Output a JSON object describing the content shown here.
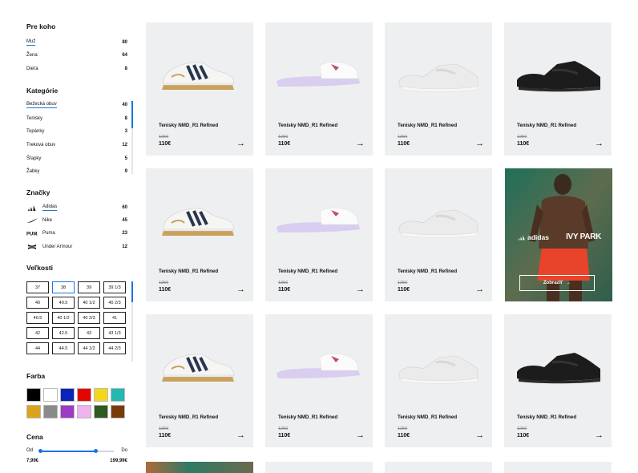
{
  "filters": {
    "audience": {
      "title": "Pre koho",
      "items": [
        {
          "label": "Muž",
          "count": "80"
        },
        {
          "label": "Žena",
          "count": "64"
        },
        {
          "label": "Dieťa",
          "count": "8"
        }
      ]
    },
    "categories": {
      "title": "Kategórie",
      "items": [
        {
          "label": "Bežecká obuv",
          "count": "40"
        },
        {
          "label": "Tenisky",
          "count": "8"
        },
        {
          "label": "Topánky",
          "count": "3"
        },
        {
          "label": "Treková obuv",
          "count": "12"
        },
        {
          "label": "Šľapky",
          "count": "5"
        },
        {
          "label": "Žabky",
          "count": "9"
        }
      ]
    },
    "brands": {
      "title": "Značky",
      "items": [
        {
          "label": "Adidas",
          "count": "60",
          "icon": "adidas-logo-icon"
        },
        {
          "label": "Nike",
          "count": "45",
          "icon": "nike-swoosh-icon"
        },
        {
          "label": "Puma",
          "count": "23",
          "icon": "puma-logo-icon"
        },
        {
          "label": "Under Armour",
          "count": "12",
          "icon": "under-armour-logo-icon"
        }
      ]
    },
    "sizes": {
      "title": "Veľkosti",
      "selected": "38",
      "items": [
        "37",
        "38",
        "39",
        "39 1/3",
        "40",
        "40.5",
        "40 1/2",
        "40 2/3",
        "40.5",
        "40 1/2",
        "40 2/3",
        "41",
        "42",
        "42.5",
        "43",
        "43 1/3",
        "44",
        "44.5",
        "44 1/2",
        "44 2/3"
      ]
    },
    "colors": {
      "title": "Farba",
      "items": [
        "#000000",
        "#ffffff",
        "#0a23b8",
        "#e10600",
        "#f2d81c",
        "#23b8b0",
        "#dba31e",
        "#8a8a8a",
        "#9b3bc6",
        "#f0b3f0",
        "#2f5a1f",
        "#7a3b0a"
      ]
    },
    "price": {
      "title": "Cena",
      "from_label": "Od",
      "to_label": "Do",
      "min": "7,99€",
      "max": "199,99€",
      "range_fraction": [
        0.0,
        0.75
      ]
    }
  },
  "products": [
    {
      "name": "Tenisky NMD_R1 Refined",
      "old_price": "125€",
      "price": "110€",
      "shoe": "white-navy-sneaker"
    },
    {
      "name": "Tenisky NMD_R1 Refined",
      "old_price": "125€",
      "price": "110€",
      "shoe": "lilac-slide"
    },
    {
      "name": "Tenisky NMD_R1 Refined",
      "old_price": "125€",
      "price": "110€",
      "shoe": "white-chunky-runner"
    },
    {
      "name": "Tenisky NMD_R1 Refined",
      "old_price": "125€",
      "price": "110€",
      "shoe": "black-chunky-runner"
    },
    {
      "name": "Tenisky NMD_R1 Refined",
      "old_price": "125€",
      "price": "110€",
      "shoe": "white-navy-sneaker"
    },
    {
      "name": "Tenisky NMD_R1 Refined",
      "old_price": "125€",
      "price": "110€",
      "shoe": "lilac-slide"
    },
    {
      "name": "Tenisky NMD_R1 Refined",
      "old_price": "125€",
      "price": "110€",
      "shoe": "white-chunky-runner"
    },
    {
      "name": "Tenisky NMD_R1 Refined",
      "old_price": "125€",
      "price": "110€",
      "shoe": "white-navy-sneaker"
    },
    {
      "name": "Tenisky NMD_R1 Refined",
      "old_price": "125€",
      "price": "110€",
      "shoe": "lilac-slide"
    },
    {
      "name": "Tenisky NMD_R1 Refined",
      "old_price": "125€",
      "price": "110€",
      "shoe": "white-chunky-runner"
    },
    {
      "name": "Tenisky NMD_R1 Refined",
      "old_price": "125€",
      "price": "110€",
      "shoe": "black-chunky-runner"
    }
  ],
  "promo": {
    "brand1": "adidas",
    "brand2": "IVY PARK",
    "button_label": "Zobraziť",
    "arrow": "→"
  },
  "arrow_symbol": "→"
}
